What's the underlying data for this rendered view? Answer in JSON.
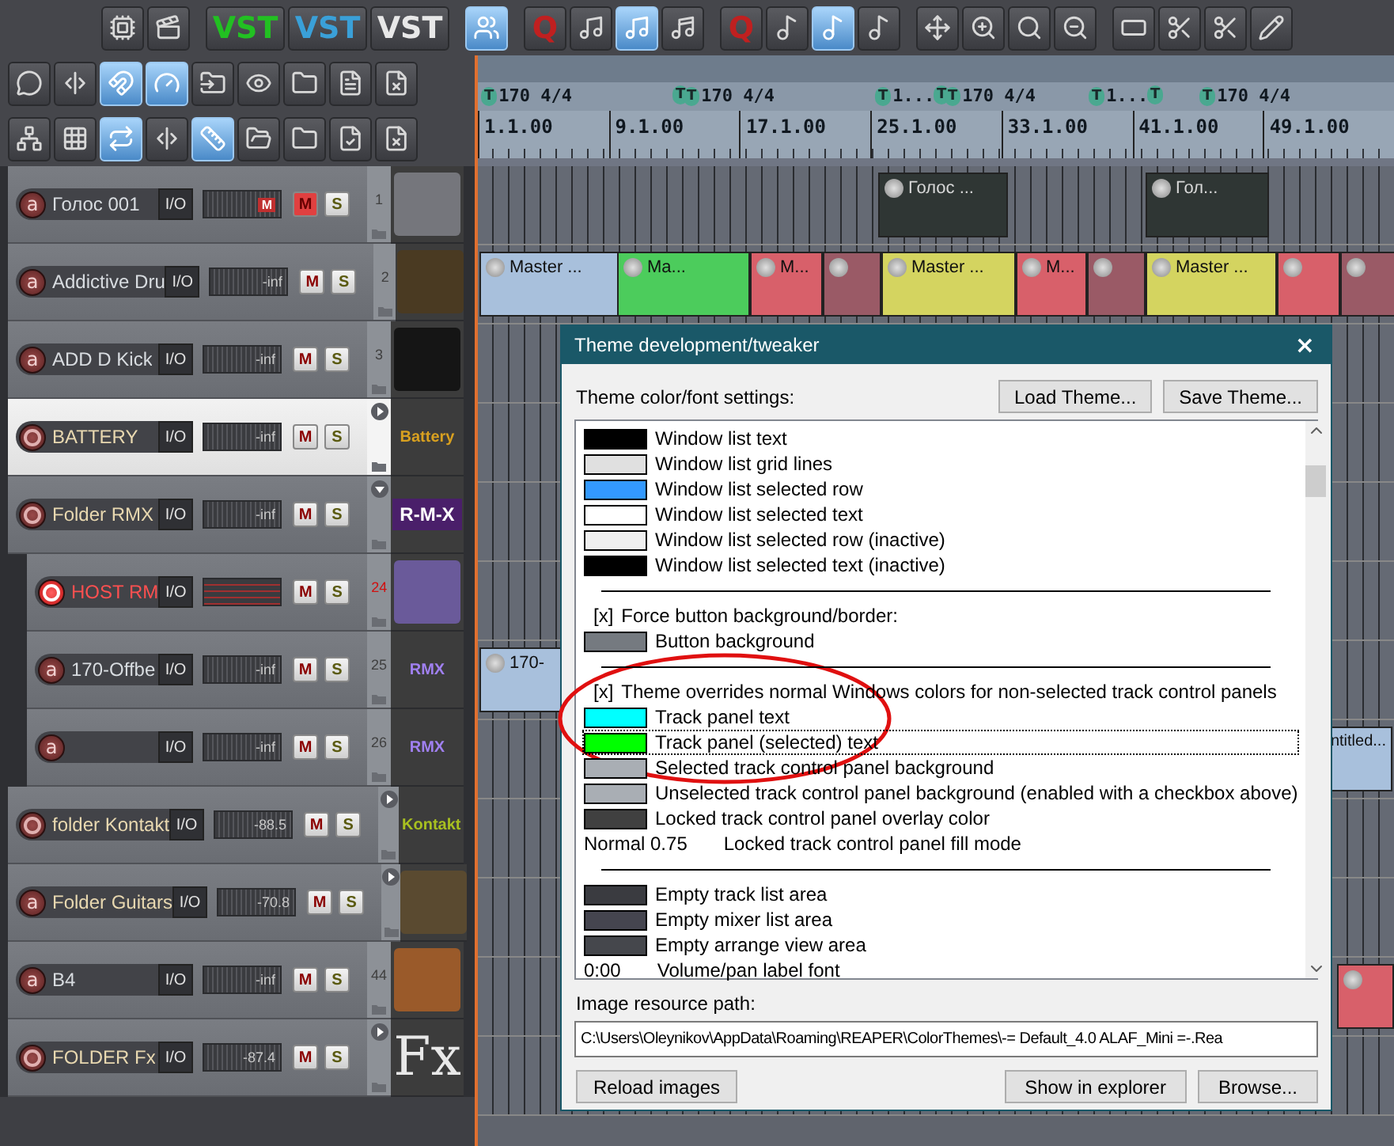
{
  "toolbar": {
    "rows": [
      [
        [
          {
            "kind": "chip",
            "pressed": false
          },
          {
            "kind": "clapper",
            "pressed": false
          }
        ],
        [
          {
            "kind": "text",
            "label": "VST",
            "color": "#22c022",
            "pressed": false
          },
          {
            "kind": "text",
            "label": "VST",
            "color": "#3aa0d8",
            "pressed": false
          },
          {
            "kind": "text",
            "label": "VST",
            "color": "#e8e8e8",
            "pressed": false
          }
        ],
        [
          {
            "kind": "walkers",
            "pressed": true
          }
        ],
        [
          {
            "kind": "text",
            "label": "Q",
            "color": "#c02020",
            "pressed": false
          },
          {
            "kind": "note",
            "pressed": false
          },
          {
            "kind": "note",
            "pressed": true
          },
          {
            "kind": "note16",
            "pressed": false
          }
        ],
        [
          {
            "kind": "text",
            "label": "Q",
            "color": "#c02020",
            "pressed": false
          },
          {
            "kind": "notegrid",
            "pressed": false
          },
          {
            "kind": "notegrid",
            "pressed": true
          },
          {
            "kind": "notegrid",
            "pressed": false
          }
        ],
        [
          {
            "kind": "expand",
            "pressed": false
          },
          {
            "kind": "zoomin",
            "pressed": false
          },
          {
            "kind": "zoomfit",
            "pressed": false
          },
          {
            "kind": "zoomout",
            "pressed": false
          }
        ],
        [
          {
            "kind": "razor",
            "pressed": false
          },
          {
            "kind": "scissors",
            "pressed": false
          },
          {
            "kind": "scissors",
            "pressed": false
          },
          {
            "kind": "pencil",
            "pressed": false
          }
        ]
      ],
      [
        [
          {
            "kind": "speech",
            "pressed": false
          },
          {
            "kind": "split",
            "pressed": false
          },
          {
            "kind": "magnet",
            "pressed": true
          },
          {
            "kind": "metronome",
            "pressed": true
          },
          {
            "kind": "folderin",
            "pressed": false
          },
          {
            "kind": "eye",
            "pressed": false
          },
          {
            "kind": "folder",
            "pressed": false
          },
          {
            "kind": "filetext",
            "pressed": false
          },
          {
            "kind": "filex",
            "pressed": false
          }
        ]
      ],
      [
        [
          {
            "kind": "network",
            "pressed": false
          },
          {
            "kind": "grid",
            "pressed": false
          },
          {
            "kind": "repeat",
            "pressed": true
          },
          {
            "kind": "split",
            "pressed": false
          },
          {
            "kind": "ruler",
            "pressed": true
          },
          {
            "kind": "folderopen",
            "pressed": false
          },
          {
            "kind": "folder",
            "pressed": false
          },
          {
            "kind": "filecheck",
            "pressed": false
          },
          {
            "kind": "filex",
            "pressed": false
          }
        ]
      ]
    ]
  },
  "timeline": {
    "markers": [
      {
        "flag": "T",
        "label": "170 4/4"
      },
      {
        "flag": "T"
      },
      {
        "flag": "T",
        "label": "170 4/4"
      },
      {
        "flag": "T",
        "label": "1..."
      },
      {
        "flag": "T"
      },
      {
        "flag": "T",
        "label": "170 4/4"
      },
      {
        "flag": "T",
        "label": "1..."
      },
      {
        "flag": "T"
      },
      {
        "flag": "T",
        "label": "170 4/4"
      }
    ],
    "ruler": [
      "1.1.00",
      "9.1.00",
      "17.1.00",
      "25.1.00",
      "33.1.00",
      "41.1.00",
      "49.1.00"
    ]
  },
  "tracks": [
    {
      "name": "Голос 001",
      "rec": {
        "label": "a",
        "armed": false
      },
      "io": "I/O",
      "meter": {
        "clip": "M"
      },
      "mute": {
        "label": "M",
        "on": true
      },
      "solo": {
        "label": "S",
        "on": false
      },
      "number": "1",
      "selected": false,
      "thumb": {
        "kind": "image",
        "color": "#75767c"
      },
      "items": [
        {
          "label": "Голос ...",
          "color": "#2f3634"
        },
        {
          "label": "Гол...",
          "color": "#2f3634"
        }
      ]
    },
    {
      "name": "Addictive Dru",
      "rec": {
        "label": "a",
        "armed": false
      },
      "io": "I/O",
      "meter": {
        "reading": "-inf"
      },
      "mute": {
        "label": "M",
        "on": false
      },
      "solo": {
        "label": "S",
        "on": false
      },
      "number": "2",
      "selected": false,
      "thumb": {
        "kind": "image",
        "color": "#4a3a22"
      },
      "items": [
        {
          "label": "Master ...",
          "color": "#a8c0dc"
        },
        {
          "label": "Ma...",
          "color": "#4ccc5c"
        },
        {
          "label": "M...",
          "color": "#d8606a"
        },
        {
          "color": "#9a5a66"
        },
        {
          "label": "Master ...",
          "color": "#d4d460"
        },
        {
          "label": "M...",
          "color": "#d8606a"
        },
        {
          "color": "#9a5a66"
        },
        {
          "label": "Master ...",
          "color": "#d4d460"
        },
        {
          "color": "#d8606a"
        },
        {
          "color": "#9a5a66"
        }
      ]
    },
    {
      "name": "ADD D Kick",
      "rec": {
        "label": "a",
        "armed": false
      },
      "io": "I/O",
      "meter": {
        "reading": "-inf"
      },
      "mute": {
        "label": "M",
        "on": false
      },
      "solo": {
        "label": "S",
        "on": false
      },
      "number": "3",
      "selected": false,
      "thumb": {
        "kind": "image",
        "color": "#151515"
      }
    },
    {
      "name": "BATTERY",
      "rec": {
        "armed": false
      },
      "io": "I/O",
      "meter": {
        "reading": "-inf"
      },
      "mute": {
        "label": "M",
        "on": false
      },
      "solo": {
        "label": "S",
        "on": false
      },
      "selected": true,
      "folder": {
        "expanded": false
      },
      "thumb": {
        "kind": "text",
        "label": "Battery",
        "color": "#d8a020"
      }
    },
    {
      "name": "Folder RMX",
      "rec": {
        "armed": false
      },
      "io": "I/O",
      "meter": {
        "reading": "-inf"
      },
      "mute": {
        "label": "M",
        "on": false
      },
      "solo": {
        "label": "S",
        "on": false
      },
      "selected": false,
      "folder": {
        "expanded": true
      },
      "thumb": {
        "kind": "banner",
        "label": "R-M-X"
      },
      "children": [
        {
          "name": "HOST RM",
          "rec": {
            "armed": true
          },
          "io": "I/O",
          "mute": {
            "label": "M",
            "on": false
          },
          "solo": {
            "label": "S",
            "on": false
          },
          "number": "24",
          "selected": false,
          "thumb": {
            "kind": "image",
            "color": "#6a5a9a"
          }
        },
        {
          "name": "170-Offbe",
          "rec": {
            "label": "a",
            "armed": false
          },
          "io": "I/O",
          "meter": {
            "reading": "-inf"
          },
          "mute": {
            "label": "M",
            "on": false
          },
          "solo": {
            "label": "S",
            "on": false
          },
          "number": "25",
          "selected": false,
          "thumb": {
            "kind": "text",
            "label": "RMX",
            "color": "#a080f0"
          },
          "items": [
            {
              "label": "170-",
              "color": "#a8c0dc"
            }
          ]
        },
        {
          "rec": {
            "label": "a",
            "armed": false
          },
          "io": "I/O",
          "meter": {
            "reading": "-inf"
          },
          "mute": {
            "label": "M",
            "on": false
          },
          "solo": {
            "label": "S",
            "on": false
          },
          "number": "26",
          "selected": false,
          "thumb": {
            "kind": "text",
            "label": "RMX",
            "color": "#a080f0"
          },
          "items": [
            {
              "label": "ntitled...",
              "color": "#a8c0dc"
            }
          ]
        }
      ]
    },
    {
      "name": "folder Kontakt",
      "rec": {
        "armed": false
      },
      "io": "I/O",
      "meter": {
        "reading": "-88.5"
      },
      "mute": {
        "label": "M",
        "on": false
      },
      "solo": {
        "label": "S",
        "on": false
      },
      "selected": false,
      "folder": {
        "expanded": false
      },
      "thumb": {
        "kind": "text",
        "label": "Kontakt",
        "color": "#a8c020"
      }
    },
    {
      "name": "Folder Guitars",
      "rec": {
        "label": "a",
        "armed": false
      },
      "io": "I/O",
      "meter": {
        "reading": "-70.8"
      },
      "mute": {
        "label": "M",
        "on": false
      },
      "solo": {
        "label": "S",
        "on": false
      },
      "selected": false,
      "folder": {
        "expanded": false
      },
      "thumb": {
        "kind": "image",
        "color": "#5a4a30"
      }
    },
    {
      "name": "B4",
      "rec": {
        "label": "a",
        "armed": false
      },
      "io": "I/O",
      "meter": {
        "reading": "-inf"
      },
      "mute": {
        "label": "M",
        "on": false
      },
      "solo": {
        "label": "S",
        "on": false
      },
      "number": "44",
      "selected": false,
      "thumb": {
        "kind": "image",
        "color": "#9a5a2a"
      },
      "items": [
        {
          "color": "#d8606a"
        }
      ]
    },
    {
      "name": "FOLDER Fx",
      "rec": {
        "armed": false
      },
      "io": "I/O",
      "meter": {
        "reading": "-87.4"
      },
      "mute": {
        "label": "M",
        "on": false
      },
      "solo": {
        "label": "S",
        "on": false
      },
      "selected": false,
      "folder": {
        "expanded": false
      },
      "thumb": {
        "kind": "serif",
        "label": "Fx",
        "color": "#e8e8e8"
      }
    }
  ],
  "dialog": {
    "title": "Theme development/tweaker",
    "close": "×",
    "settings_label": "Theme color/font settings:",
    "buttons_top": [
      "Load Theme...",
      "Save Theme..."
    ],
    "list": [
      {
        "kind": "swatch",
        "color": "#000000",
        "label": "Window list text",
        "focused": false
      },
      {
        "kind": "swatch",
        "color": "#e0e0e0",
        "label": "Window list grid lines",
        "focused": false
      },
      {
        "kind": "swatch",
        "color": "#3399ff",
        "label": "Window list selected row",
        "focused": false
      },
      {
        "kind": "swatch",
        "color": "#ffffff",
        "label": "Window list selected text",
        "focused": false
      },
      {
        "kind": "swatch",
        "color": "#f0f0f0",
        "label": "Window list selected row (inactive)",
        "focused": false
      },
      {
        "kind": "swatch",
        "color": "#000000",
        "label": "Window list selected text (inactive)",
        "focused": false
      },
      {
        "kind": "separator"
      },
      {
        "kind": "option",
        "mark": "[x]",
        "label": "Force button background/border:"
      },
      {
        "kind": "swatch",
        "color": "#757a80",
        "label": "Button background",
        "focused": false
      },
      {
        "kind": "separator"
      },
      {
        "kind": "option",
        "mark": "[x]",
        "label": "Theme overrides normal Windows colors for non-selected track control panels"
      },
      {
        "kind": "swatch",
        "color": "#00ffff",
        "label": "Track panel text",
        "focused": false
      },
      {
        "kind": "swatch",
        "color": "#00ff00",
        "label": "Track panel (selected) text",
        "focused": true
      },
      {
        "kind": "swatch",
        "color": "#a9aeb4",
        "label": "Selected track control panel background",
        "focused": false
      },
      {
        "kind": "swatch",
        "color": "#a9aeb4",
        "label": "Unselected track control panel background (enabled with a checkbox above)",
        "focused": false
      },
      {
        "kind": "swatch",
        "color": "#404040",
        "label": "Locked track control panel overlay color",
        "focused": false
      },
      {
        "kind": "value",
        "setting": "Normal 0.75",
        "label": "Locked track control panel fill mode"
      },
      {
        "kind": "separator"
      },
      {
        "kind": "swatch",
        "color": "#3a3b40",
        "label": "Empty track list area",
        "focused": false
      },
      {
        "kind": "swatch",
        "color": "#45454f",
        "label": "Empty mixer list area",
        "focused": false
      },
      {
        "kind": "swatch",
        "color": "#45474c",
        "label": "Empty arrange view area",
        "focused": false
      },
      {
        "kind": "value",
        "setting": "0:00",
        "label": "Volume/pan label font"
      }
    ],
    "path_label": "Image resource path:",
    "path_value": "C:\\Users\\Oleynikov\\AppData\\Roaming\\REAPER\\ColorThemes\\-= Default_4.0 ALAF_Mini =-.Rea",
    "buttons_bottom": [
      "Reload images",
      "Show in explorer",
      "Browse..."
    ]
  }
}
